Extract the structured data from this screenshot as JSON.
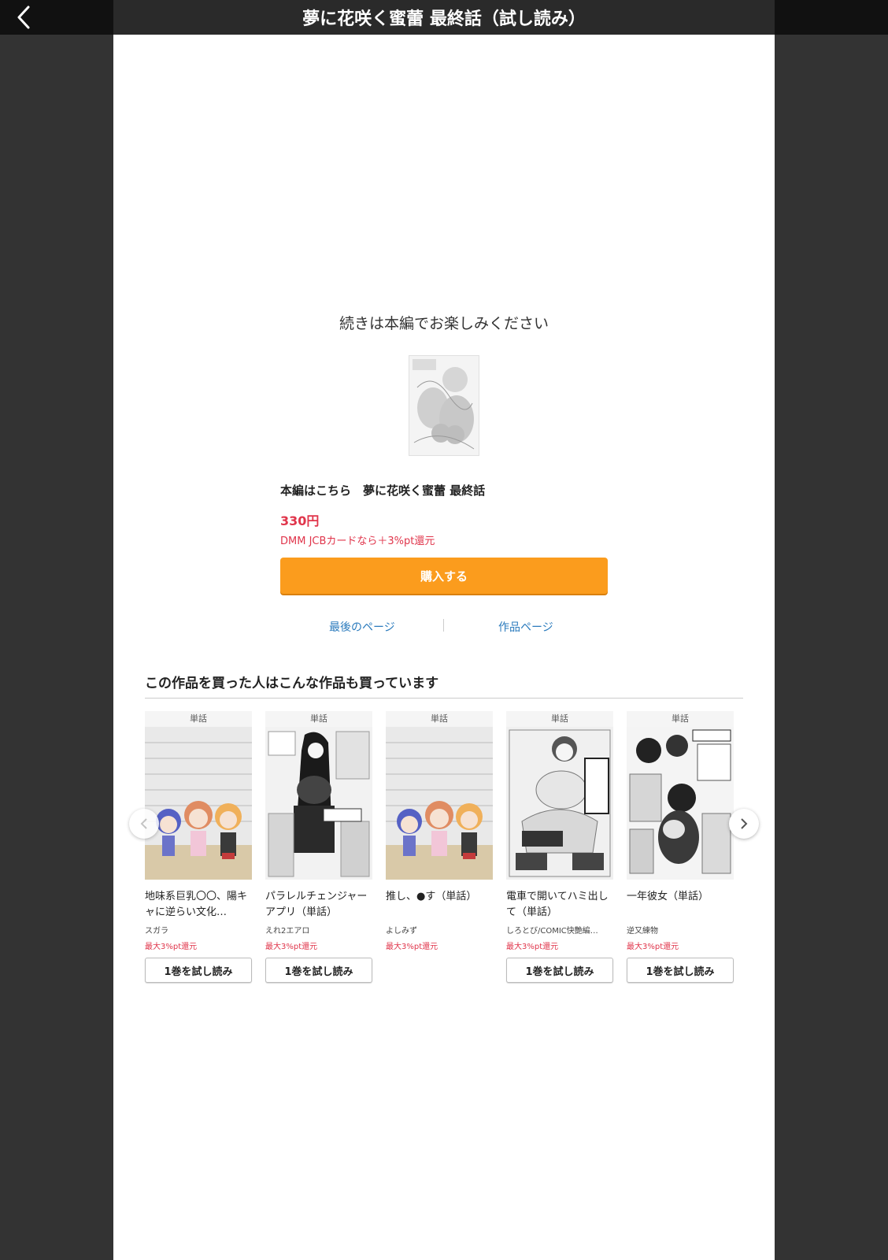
{
  "header": {
    "title": "夢に花咲く蜜蕾 最終話（試し読み）",
    "back_icon": "chevron-left-icon"
  },
  "end_panel": {
    "continue_text": "続きは本編でお楽しみください",
    "product_title": "本編はこちら　夢に花咲く蜜蕾 最終話",
    "price": "330円",
    "point_note": "DMM JCBカードなら＋3%pt還元",
    "buy_label": "購入する",
    "last_page_label": "最後のページ",
    "work_page_label": "作品ページ"
  },
  "recommendations": {
    "heading": "この作品を買った人はこんな作品も買っています",
    "items": [
      {
        "badge": "単話",
        "title": "地味系巨乳〇〇、陽キャに逆らい文化…",
        "author": "スガラ",
        "points": "最大3%pt還元",
        "button": "1巻を試し読み"
      },
      {
        "badge": "単話",
        "title": "パラレルチェンジャーアプリ（単話）",
        "author": "えれ2エアロ",
        "points": "最大3%pt還元",
        "button": "1巻を試し読み"
      },
      {
        "badge": "単話",
        "title": "推し、●す（単話）",
        "author": "よしみず",
        "points": "最大3%pt還元",
        "button": ""
      },
      {
        "badge": "単話",
        "title": "電車で開いてハミ出して（単話）",
        "author": "しろとび/COMIC快艶編…",
        "points": "最大3%pt還元",
        "button": "1巻を試し読み"
      },
      {
        "badge": "単話",
        "title": "一年彼女（単話）",
        "author": "逆又練物",
        "points": "最大3%pt還元",
        "button": "1巻を試し読み"
      }
    ]
  },
  "colors": {
    "accent_orange": "#fb9c1d",
    "price_red": "#e0354b",
    "link_blue": "#2b7bbd",
    "viewer_bg": "#333333"
  }
}
